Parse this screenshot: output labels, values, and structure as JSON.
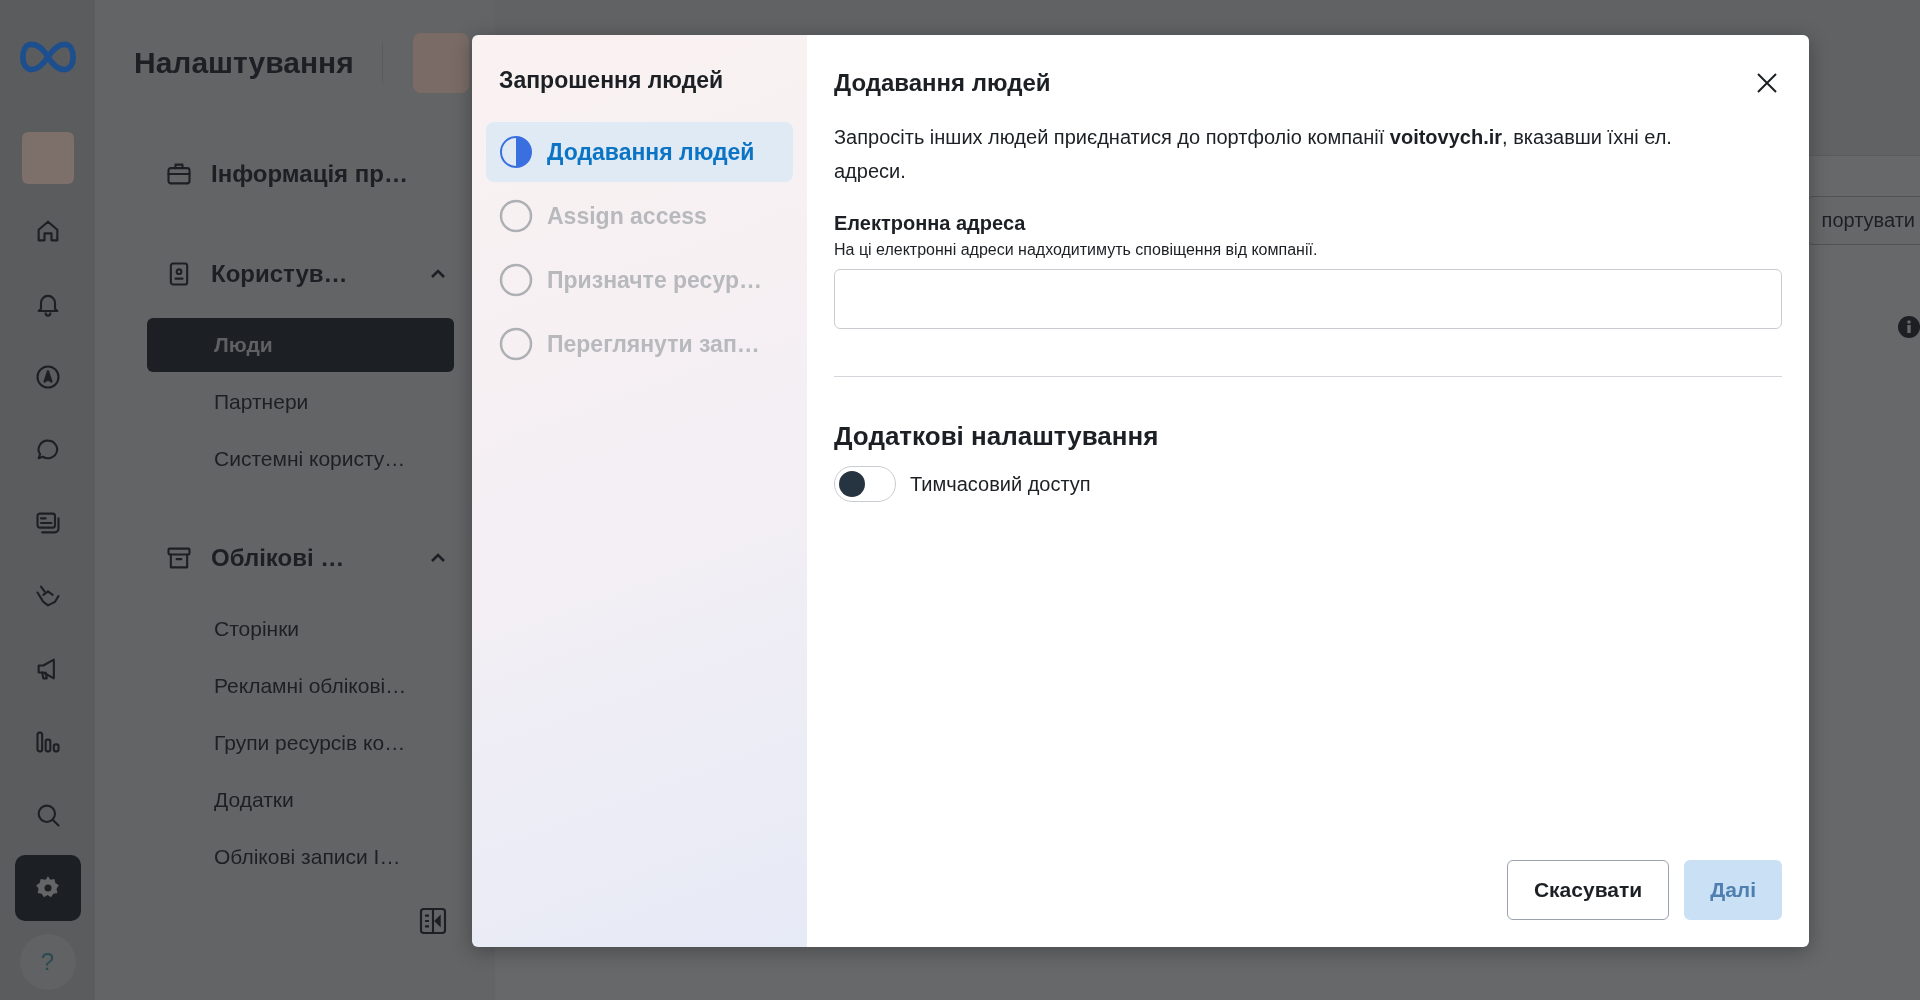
{
  "rail": {
    "items": [
      {
        "selected": false
      },
      {
        "selected": false
      },
      {
        "selected": false
      },
      {
        "selected": false
      },
      {
        "selected": false
      },
      {
        "selected": false
      },
      {
        "selected": false
      },
      {
        "selected": false
      },
      {
        "selected": false
      },
      {
        "selected": false
      },
      {
        "selected": true
      }
    ],
    "help_label": "?"
  },
  "sidebar": {
    "title": "Налаштування",
    "sections": [
      {
        "kind": "link",
        "label": "Інформація пр…"
      },
      {
        "kind": "group",
        "label": "Користув…",
        "expanded": true,
        "items": [
          {
            "label": "Люди",
            "selected": true
          },
          {
            "label": "Партнери",
            "selected": false
          },
          {
            "label": "Системні користу…",
            "selected": false
          }
        ]
      },
      {
        "kind": "group",
        "label": "Облікові …",
        "expanded": true,
        "items": [
          {
            "label": "Сторінки",
            "selected": false
          },
          {
            "label": "Рекламні облікові…",
            "selected": false
          },
          {
            "label": "Групи ресурсів ко…",
            "selected": false
          },
          {
            "label": "Додатки",
            "selected": false
          },
          {
            "label": "Облікові записи I…",
            "selected": false
          }
        ]
      }
    ]
  },
  "background": {
    "export_button": "портувати"
  },
  "modal": {
    "steps_title": "Запрошення людей",
    "steps": [
      {
        "label": "Додавання людей",
        "selected": true
      },
      {
        "label": "Assign access",
        "selected": false
      },
      {
        "label": "Призначте ресур…",
        "selected": false
      },
      {
        "label": "Переглянути зап…",
        "selected": false
      }
    ],
    "title": "Додавання людей",
    "description": "Запросіть інших людей приєднатися до портфоліо компанії **voitovych.ir**, вказавши їхні ел. адреси.",
    "email_label": "Електронна адреса",
    "email_hint": "На ці електронні адреси надходитимуть сповіщення від компанії.",
    "settings_heading": "Додаткові налаштування",
    "toggle": {
      "label": "Тимчасовий доступ",
      "on": false
    },
    "cancel_button": {
      "label": "Скасувати"
    },
    "next_button": {
      "label": "Далі",
      "disabled": true
    }
  }
}
